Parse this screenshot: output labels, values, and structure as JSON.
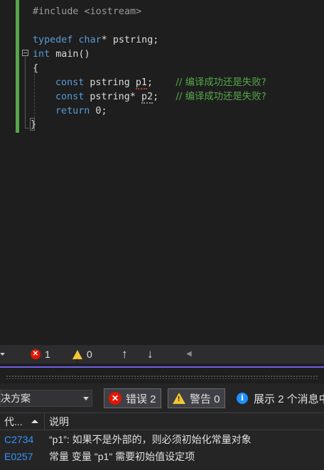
{
  "editor": {
    "lines": {
      "include": "#include <iostream>",
      "typedef_kw": "typedef",
      "typedef_type": "char",
      "typedef_rest": "* pstring;",
      "main_kw": "int",
      "main_rest": " main()",
      "open_brace": "{",
      "l1_kw": "const",
      "l1_type": " pstring ",
      "l1_var": "p1",
      "l1_semi": ";",
      "l1_comment": "// 编译成功还是失败?",
      "l2_kw": "const",
      "l2_type": " pstring* ",
      "l2_var": "p2",
      "l2_semi": ";",
      "l2_comment": "// 编译成功还是失败?",
      "l3_kw": "return",
      "l3_rest": " 0;",
      "close_brace": "}"
    }
  },
  "statusbar": {
    "errors": "1",
    "warnings": "0",
    "up_arrow": "↑",
    "down_arrow": "↓",
    "left_arrow": "◀"
  },
  "error_list": {
    "scope": "决方案",
    "errors_filter": "错误 2",
    "warnings_filter": "警告 0",
    "messages_filter": "展示 2 个消息中",
    "columns": {
      "code": "代...",
      "description": "说明"
    },
    "rows": [
      {
        "code": "C2734",
        "description": "“p1”: 如果不是外部的，则必须初始化常量对象"
      },
      {
        "code": "E0257",
        "description": "常量 变量 \"p1\" 需要初始值设定项"
      }
    ]
  },
  "colors": {
    "accent": "#7160e8",
    "keyword": "#569cd6",
    "comment": "#57a64a",
    "error": "#e51400",
    "warning": "#f2c531",
    "link": "#3794ff"
  }
}
